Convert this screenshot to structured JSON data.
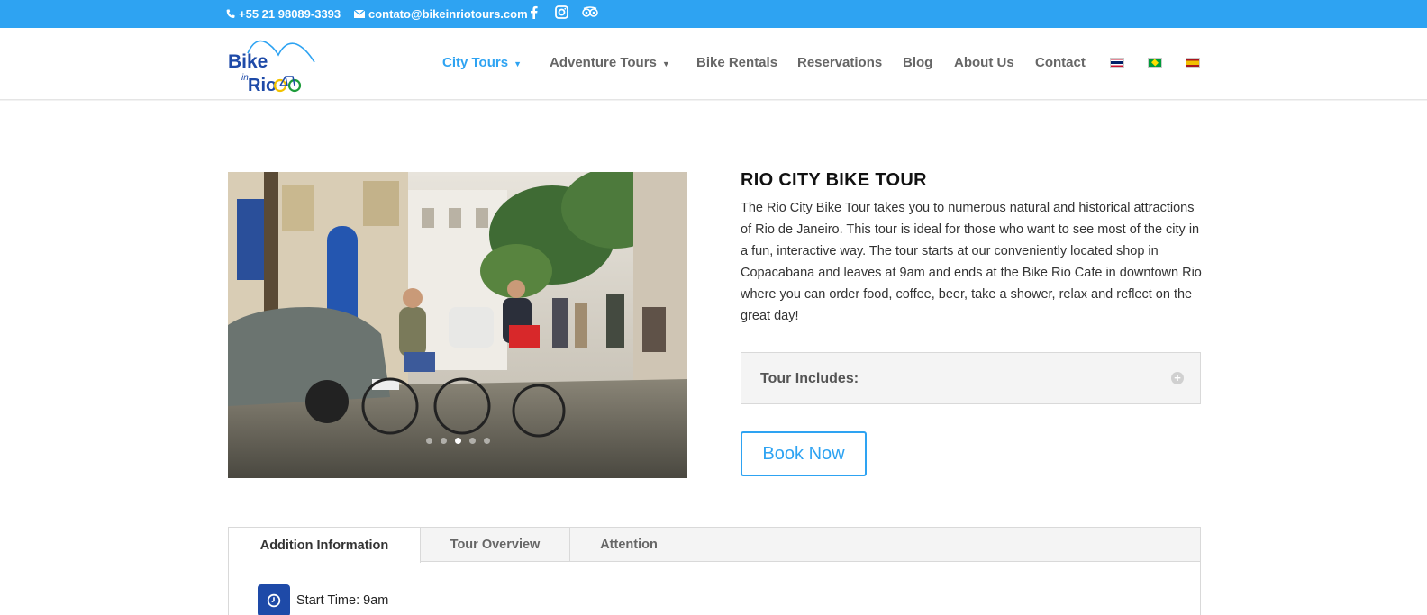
{
  "topbar": {
    "phone": "+55 21 98089-3393",
    "email": "contato@bikeinriotours.com",
    "social_icons": [
      "facebook-icon",
      "instagram-icon",
      "tripadvisor-icon"
    ]
  },
  "header": {
    "logo_word_1": "Bike",
    "logo_word_2": "in",
    "logo_word_3": "Rio",
    "nav": [
      {
        "label": "City Tours",
        "has_dropdown": true,
        "active": true
      },
      {
        "label": "Adventure Tours",
        "has_dropdown": true,
        "active": false
      },
      {
        "label": "Bike Rentals",
        "has_dropdown": false,
        "active": false
      },
      {
        "label": "Reservations",
        "has_dropdown": false,
        "active": false
      },
      {
        "label": "Blog",
        "has_dropdown": false,
        "active": false
      },
      {
        "label": "About Us",
        "has_dropdown": false,
        "active": false
      },
      {
        "label": "Contact",
        "has_dropdown": false,
        "active": false
      }
    ],
    "languages": [
      "english-flag",
      "portuguese-flag",
      "spanish-flag"
    ]
  },
  "slider": {
    "slide_count": 5,
    "active_index": 2
  },
  "tour": {
    "title": "RIO CITY BIKE TOUR",
    "description": "The Rio City Bike Tour takes you to numerous natural and historical attractions of Rio de Janeiro. This tour is ideal for those who want to see most of the city in a fun, interactive way. The tour starts at our conveniently located shop in Copacabana and leaves at 9am and ends at the Bike Rio Cafe in downtown Rio where you can order food, coffee, beer, take a shower, relax and reflect on the great day!",
    "includes_label": "Tour Includes:",
    "book_label": "Book Now"
  },
  "tabs": {
    "items": [
      "Addition Information",
      "Tour Overview",
      "Attention"
    ],
    "active_index": 0,
    "start_time": "Start Time: 9am"
  },
  "colors": {
    "accent": "#2ea3f2",
    "icon_blue": "#1e4aa8"
  }
}
